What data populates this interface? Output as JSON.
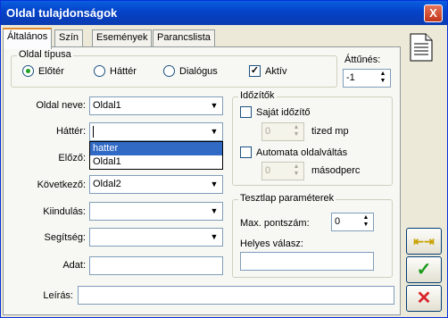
{
  "window": {
    "title": "Oldal tulajdonságok",
    "close_glyph": "X"
  },
  "tabs": [
    "Általános",
    "Szín",
    "Események",
    "Parancslista"
  ],
  "page_type": {
    "title": "Oldal típusa",
    "options": [
      "Előtér",
      "Háttér",
      "Dialógus"
    ],
    "selected": "Előtér",
    "active_label": "Aktív",
    "active_checked": true
  },
  "fade": {
    "label": "Áttűnés:",
    "value": "-1"
  },
  "form": {
    "page_name_label": "Oldal neve:",
    "page_name_value": "Oldal1",
    "background_label": "Háttér:",
    "background_value": "",
    "background_options": [
      "hatter",
      "Oldal1"
    ],
    "previous_label": "Előző:",
    "next_label": "Következő:",
    "next_value": "Oldal2",
    "start_label": "Kiindulás:",
    "start_value": "",
    "help_label": "Segítség:",
    "help_value": "",
    "data_label": "Adat:",
    "data_value": "",
    "description_label": "Leírás:",
    "description_value": ""
  },
  "timer": {
    "title": "Időzítők",
    "own_timer_label": "Saját időzítő",
    "own_timer_value": "0",
    "own_timer_unit": "tized mp",
    "auto_switch_label": "Automata oldalváltás",
    "auto_switch_value": "0",
    "auto_switch_unit": "másodperc"
  },
  "test": {
    "title": "Tesztlap paraméterek",
    "max_score_label": "Max. pontszám:",
    "max_score_value": "0",
    "correct_answer_label": "Helyes válasz:",
    "correct_answer_value": ""
  },
  "side_buttons": {
    "split_glyph": "⇤⇥",
    "ok_glyph": "✓",
    "cancel_glyph": "✕"
  },
  "colors": {
    "title_blue": "#0442c8",
    "ok_green": "#1a9a1a",
    "cancel_red": "#d8232a"
  }
}
